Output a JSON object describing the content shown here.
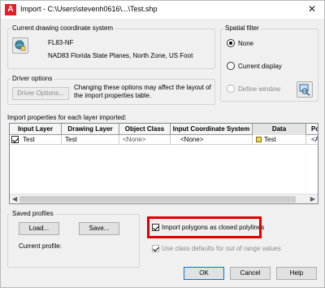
{
  "window": {
    "title": "Import - C:\\Users\\stevenh0616\\...\\Test.shp",
    "close_glyph": "✕"
  },
  "coordinate_system": {
    "group_label": "Current drawing coordinate system",
    "code": "FL83-NF",
    "description": "NAD83 Florida State Planes, North Zone, US Foot"
  },
  "spatial_filter": {
    "group_label": "Spatial filter",
    "options": [
      {
        "label": "None",
        "selected": true,
        "enabled": true
      },
      {
        "label": "Current display",
        "selected": false,
        "enabled": true
      },
      {
        "label": "Define window",
        "selected": false,
        "enabled": false
      }
    ]
  },
  "driver_options": {
    "group_label": "Driver options",
    "button_label": "Driver Options...",
    "note": "Changing these options may affect the layout of the import properties table."
  },
  "import_table": {
    "section_label": "Import properties for each layer imported:",
    "columns": [
      "Input Layer",
      "Drawing Layer",
      "Object Class",
      "Input Coordinate System",
      "Data",
      "Po"
    ],
    "rows": [
      {
        "checked": true,
        "input_layer": "Test",
        "drawing_layer": "Test",
        "object_class": "<None>",
        "input_coordinate_system": "<None>",
        "data": "Test",
        "points": "<ACAD"
      }
    ]
  },
  "saved_profiles": {
    "group_label": "Saved profiles",
    "load_label": "Load...",
    "save_label": "Save...",
    "current_profile_label": "Current profile:"
  },
  "import_options": {
    "polygons_label": "Import polygons as closed polylines",
    "polygons_checked": true,
    "class_defaults_label": "Use class defaults for out of range values",
    "class_defaults_checked": true
  },
  "footer": {
    "ok_label": "OK",
    "cancel_label": "Cancel",
    "help_label": "Help"
  },
  "colors": {
    "highlight": "#e00000",
    "accent": "#0078d7",
    "app_icon": "#e41f26"
  }
}
